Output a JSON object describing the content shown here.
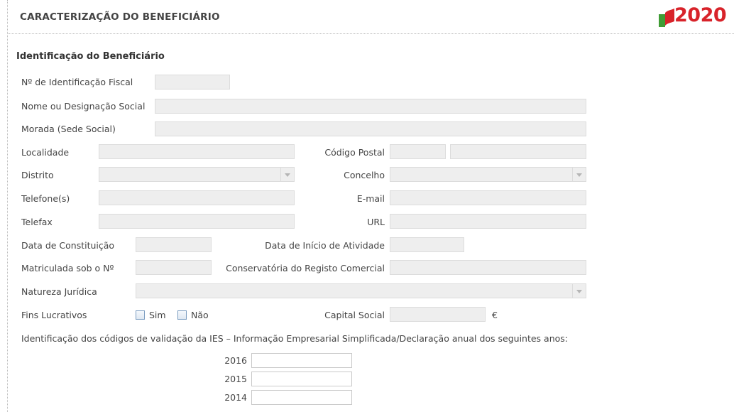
{
  "header": {
    "title": "CARACTERIZAÇÃO DO BENEFICIÁRIO",
    "logo_text": "2020"
  },
  "section": {
    "title": "Identificação do Beneficiário"
  },
  "fields": {
    "nif": {
      "label": "Nº de Identificação Fiscal",
      "value": ""
    },
    "nome": {
      "label": "Nome ou Designação Social",
      "value": ""
    },
    "morada": {
      "label": "Morada (Sede Social)",
      "value": ""
    },
    "localidade": {
      "label": "Localidade",
      "value": ""
    },
    "codigo_postal": {
      "label": "Código Postal",
      "value1": "",
      "value2": ""
    },
    "distrito": {
      "label": "Distrito",
      "value": ""
    },
    "concelho": {
      "label": "Concelho",
      "value": ""
    },
    "telefone": {
      "label": "Telefone(s)",
      "value": ""
    },
    "email": {
      "label": "E-mail",
      "value": ""
    },
    "telefax": {
      "label": "Telefax",
      "value": ""
    },
    "url": {
      "label": "URL",
      "value": ""
    },
    "data_constituicao": {
      "label": "Data de Constituição",
      "value": ""
    },
    "data_inicio": {
      "label": "Data de Início de Atividade",
      "value": ""
    },
    "matricula": {
      "label": "Matriculada sob o Nº",
      "value": ""
    },
    "conservatoria": {
      "label": "Conservatória do Registo Comercial",
      "value": ""
    },
    "natureza": {
      "label": "Natureza Jurídica",
      "value": ""
    },
    "fins_lucrativos": {
      "label": "Fins Lucrativos",
      "option_sim": "Sim",
      "option_nao": "Não",
      "sim_checked": false,
      "nao_checked": false
    },
    "capital_social": {
      "label": "Capital Social",
      "value": "",
      "currency": "€"
    }
  },
  "ies": {
    "text": "Identificação dos códigos de validação da IES – Informação Empresarial Simplificada/Declaração anual dos seguintes anos:",
    "years": [
      {
        "year": "2016",
        "value": ""
      },
      {
        "year": "2015",
        "value": ""
      },
      {
        "year": "2014",
        "value": ""
      }
    ]
  },
  "colors": {
    "brand_red": "#d8232a",
    "brand_green": "#3f9c35",
    "field_bg": "#eeeeee",
    "field_border": "#dcdcdc"
  }
}
